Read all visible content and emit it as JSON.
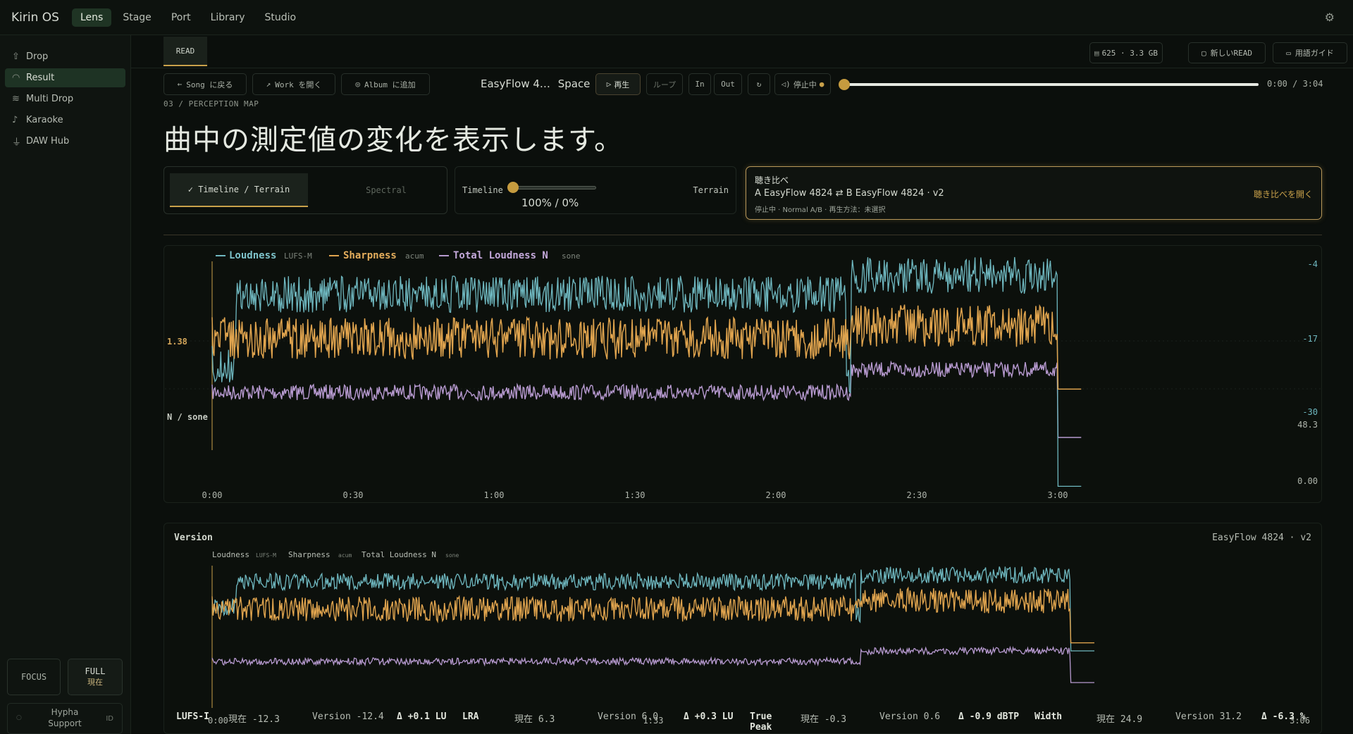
{
  "app": {
    "brand": "Kirin OS",
    "settings_icon": "gear-icon"
  },
  "nav": {
    "tabs": [
      "Lens",
      "Stage",
      "Port",
      "Library",
      "Studio"
    ],
    "active": "Lens"
  },
  "sidebar": {
    "items": [
      {
        "label": "Drop",
        "icon": "upload-icon"
      },
      {
        "label": "Result",
        "icon": "gauge-icon",
        "active": true
      },
      {
        "label": "Multi Drop",
        "icon": "layers-icon"
      },
      {
        "label": "Karaoke",
        "icon": "mic-icon"
      },
      {
        "label": "DAW Hub",
        "icon": "plug-icon"
      }
    ],
    "focus_label": "FOCUS",
    "full_label": "FULL",
    "full_sub": "現在",
    "support_line1": "Hypha",
    "support_line2": "Support",
    "support_badge": "ID"
  },
  "header": {
    "read_tab": "READ",
    "storage": "625 · 3.3 GB",
    "new_read": "新しいREAD",
    "glossary": "用語ガイド"
  },
  "toolbar": {
    "back_song": "Song に戻る",
    "open_work": "Work を開く",
    "add_album": "Album に追加",
    "song_title": "EasyFlow 4…",
    "shortcut": "Space",
    "play": "再生",
    "loop": "ループ",
    "in": "In",
    "out": "Out",
    "status": "停止中",
    "time": "0:00 / 3:04",
    "progress": 0.0
  },
  "page": {
    "section": "03 / PERCEPTION MAP",
    "title": "曲中の測定値の変化を表示します。"
  },
  "controls": {
    "mode_timeline": "✓ Timeline / Terrain",
    "mode_spectral": "Spectral",
    "blend_left": "Timeline",
    "blend_right": "Terrain",
    "blend_value": "100% / 0%",
    "blend_fraction": 1.0
  },
  "compare": {
    "title": "聴き比べ",
    "ab": "A EasyFlow 4824 ⇄ B EasyFlow 4824 · v2",
    "status": "停止中 · Normal A/B · 再生方法：未選択",
    "open": "聴き比べを開く"
  },
  "chart_data": [
    {
      "type": "line",
      "legend": [
        {
          "name": "Loudness",
          "unit": "LUFS-M",
          "color": "#6fb8c0"
        },
        {
          "name": "Sharpness",
          "unit": "acum",
          "color": "#e0a44e"
        },
        {
          "name": "Total Loudness N",
          "unit": "sone",
          "color": "#b79ad0"
        }
      ],
      "x_ticks": [
        "0:00",
        "0:30",
        "1:00",
        "1:30",
        "2:00",
        "2:30",
        "3:00"
      ],
      "x_range_seconds": [
        0,
        185
      ],
      "right_ticks": [
        "-4",
        "-17",
        "-30",
        "48.3",
        "0.00"
      ],
      "left_labels": [
        "1.38",
        "N / sone"
      ],
      "series_segments": {
        "Loudness_LUFS": [
          {
            "from": "0:00",
            "to": "0:05",
            "level": -26
          },
          {
            "from": "0:05",
            "to": "2:15",
            "level": -11
          },
          {
            "from": "2:15",
            "to": "2:16",
            "level": -30
          },
          {
            "from": "2:16",
            "to": "3:00",
            "level": -7
          },
          {
            "from": "3:00",
            "to": "3:05",
            "level": -52
          }
        ],
        "Sharpness_acum": [
          {
            "from": "0:00",
            "to": "2:16",
            "level": 1.4
          },
          {
            "from": "2:16",
            "to": "3:00",
            "level": 1.5
          },
          {
            "from": "3:00",
            "to": "3:05",
            "level": 1.0
          }
        ],
        "Total_Loudness_sone": [
          {
            "from": "0:00",
            "to": "2:16",
            "level": 20
          },
          {
            "from": "2:16",
            "to": "3:00",
            "level": 30
          },
          {
            "from": "3:00",
            "to": "3:05",
            "level": 0
          }
        ]
      }
    },
    {
      "type": "line",
      "title": "Version",
      "version_name": "EasyFlow 4824 · v2",
      "legend": [
        {
          "name": "Loudness",
          "unit": "LUFS-M",
          "color": "#6fb8c0"
        },
        {
          "name": "Sharpness",
          "unit": "acum",
          "color": "#e0a44e"
        },
        {
          "name": "Total Loudness N",
          "unit": "sone",
          "color": "#b79ad0"
        }
      ],
      "x_ticks": [
        "0:00",
        "1:33",
        "3:06"
      ],
      "x_range_seconds": [
        0,
        186
      ]
    }
  ],
  "metrics": {
    "lufs_label": "LUFS-I",
    "lufs_now": "現在 -12.3",
    "lufs_version": "Version -12.4",
    "lufs_delta": "Δ +0.1 LU",
    "lra_label": "LRA",
    "lra_now": "現在 6.3",
    "lra_version": "Version 6.0",
    "lra_delta": "Δ +0.3 LU",
    "tp_label1": "True",
    "tp_label2": "Peak",
    "tp_now": "現在 -0.3",
    "tp_version": "Version 0.6",
    "tp_delta": "Δ -0.9 dBTP",
    "width_label": "Width",
    "width_now": "現在 24.9",
    "width_version": "Version 31.2",
    "width_delta": "Δ -6.3 %"
  },
  "colors": {
    "accent": "#c9a14a",
    "loudness": "#6fb8c0",
    "sharpness": "#e0a44e",
    "total": "#b79ad0"
  }
}
